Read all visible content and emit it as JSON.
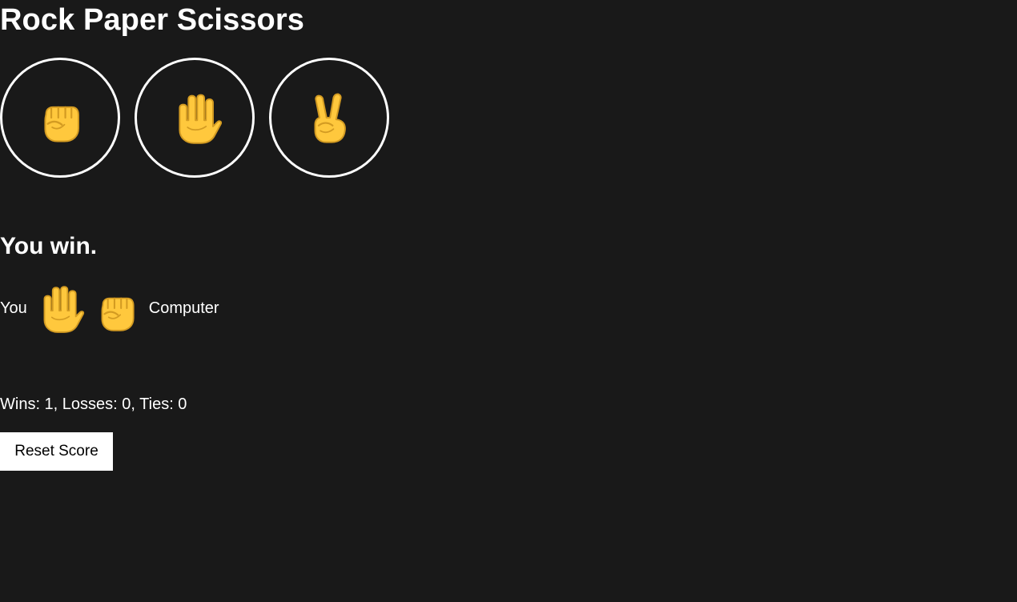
{
  "app": {
    "title": "Rock Paper Scissors"
  },
  "choices": [
    {
      "id": "rock",
      "icon": "rock-fist-icon"
    },
    {
      "id": "paper",
      "icon": "paper-hand-icon"
    },
    {
      "id": "scissors",
      "icon": "scissors-hand-icon"
    }
  ],
  "result": {
    "message": "You win.",
    "player_label": "You",
    "player_move_icon": "paper-hand-icon",
    "computer_move_icon": "rock-fist-icon",
    "computer_label": "Computer"
  },
  "score": {
    "text": "Wins: 1, Losses: 0, Ties: 0",
    "wins": 1,
    "losses": 0,
    "ties": 0
  },
  "controls": {
    "reset_label": "Reset Score"
  },
  "colors": {
    "background": "#191919",
    "text": "#ffffff",
    "hand": "#ffc83d",
    "hand_outline": "#d39b22",
    "button_background": "#ffffff",
    "button_text": "#000000"
  }
}
